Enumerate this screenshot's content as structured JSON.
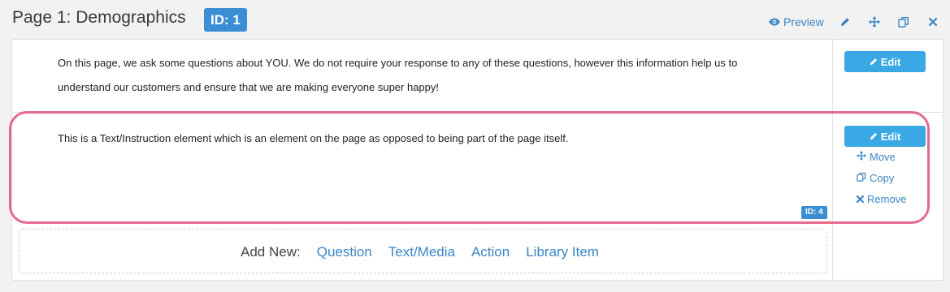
{
  "header": {
    "title": "Page 1: Demographics",
    "id_badge": "ID: 1",
    "preview_label": "Preview",
    "actions": [
      "preview-icon",
      "pencil-icon",
      "move-icon",
      "copy-icon",
      "close-icon"
    ]
  },
  "sections": [
    {
      "text_lines": [
        "On this page, we ask some questions about YOU. We do not require your response to any of these questions, however this information help us to",
        "understand our customers and ensure that we are making everyone super happy!"
      ],
      "edit_label": "Edit"
    },
    {
      "text_lines": [
        "This is a Text/Instruction element which is an element on the page as opposed to being part of the page itself."
      ],
      "edit_label": "Edit",
      "move_label": "Move",
      "copy_label": "Copy",
      "remove_label": "Remove",
      "id_badge": "ID: 4"
    }
  ],
  "add_new": {
    "label": "Add New:",
    "links": [
      "Question",
      "Text/Media",
      "Action",
      "Library Item"
    ]
  },
  "colors": {
    "accent": "#3aa8e4",
    "badge": "#3b8dd4",
    "link": "#3a85c6",
    "highlight": "#e66a8e"
  }
}
